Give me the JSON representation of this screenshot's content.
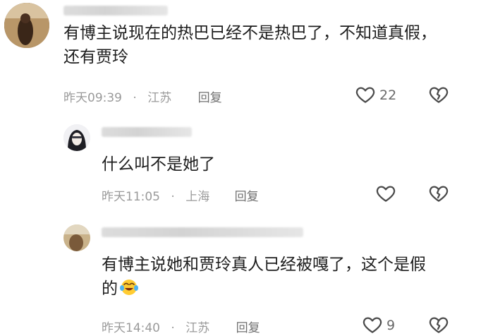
{
  "comments": [
    {
      "text_line1": "有博主说现在的热巴已经不是热巴了，不知道真假，",
      "text_line2": "还有贾玲",
      "time": "昨天09:39",
      "sep": "·",
      "location": "江苏",
      "reply": "回复",
      "likes": "22"
    },
    {
      "text_line1": "什么叫不是她了",
      "time": "昨天11:05",
      "sep": "·",
      "location": "上海",
      "reply": "回复"
    },
    {
      "text_line1": "有博主说她和贾玲真人已经被嘎了，这个是假",
      "text_line2": "的",
      "time": "昨天14:40",
      "sep": "·",
      "location": "江苏",
      "reply": "回复",
      "likes": "9"
    }
  ],
  "icons": {
    "like": "heart-outline-icon",
    "dislike": "broken-heart-icon",
    "emoji": "crying-laughing-emoji-icon"
  },
  "colors": {
    "text": "#1d1d1d",
    "meta": "#9a9a9a",
    "icon": "#4a4a4a"
  }
}
